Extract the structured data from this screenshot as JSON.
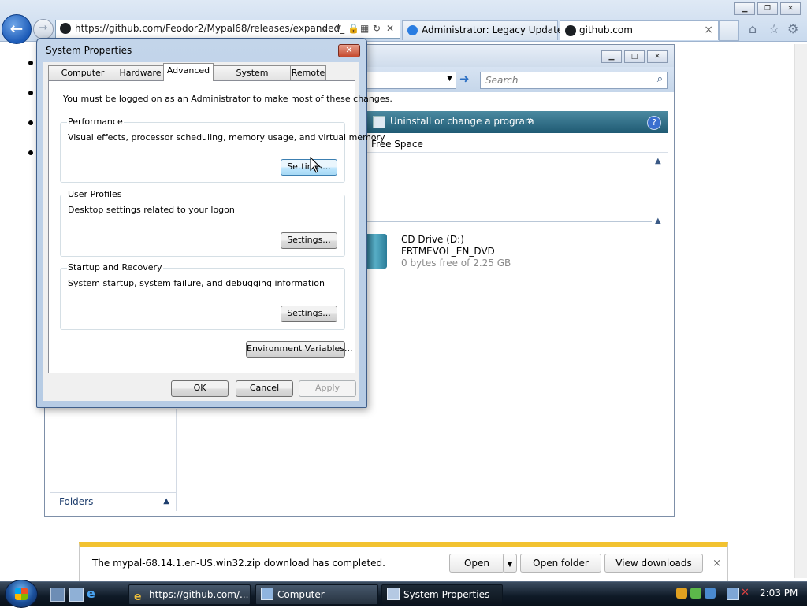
{
  "browser": {
    "address_url": "https://github.com/Feodor2/Mypal68/releases/expanded_",
    "tabs": [
      {
        "label": "Administrator: Legacy Update"
      },
      {
        "label": "github.com"
      }
    ],
    "tab_close_glyph": "×"
  },
  "explorer": {
    "search_placeholder": "Search",
    "uninstall_label": "Uninstall or change a program",
    "uninstall_more": "»",
    "help_glyph": "?",
    "free_space_column": "Free Space",
    "cd_drive": {
      "name": "CD Drive (D:)",
      "volume": "FRTMEVOL_EN_DVD",
      "free": "0 bytes free of 2.25 GB"
    },
    "folders_label": "Folders"
  },
  "system_properties": {
    "title": "System Properties",
    "close_glyph": "✕",
    "tabs": [
      "Computer Name",
      "Hardware",
      "Advanced",
      "System Protection",
      "Remote"
    ],
    "active_tab": "Advanced",
    "admin_note": "You must be logged on as an Administrator to make most of these changes.",
    "groups": [
      {
        "title": "Performance",
        "description": "Visual effects, processor scheduling, memory usage, and virtual memory",
        "button": "Settings..."
      },
      {
        "title": "User Profiles",
        "description": "Desktop settings related to your logon",
        "button": "Settings..."
      },
      {
        "title": "Startup and Recovery",
        "description": "System startup, system failure, and debugging information",
        "button": "Settings..."
      }
    ],
    "env_button": "Environment Variables...",
    "ok_label": "OK",
    "cancel_label": "Cancel",
    "apply_label": "Apply"
  },
  "download_bar": {
    "message": "The mypal-68.14.1.en-US.win32.zip download has completed.",
    "open_label": "Open",
    "open_folder_label": "Open folder",
    "view_downloads_label": "View downloads",
    "close_glyph": "×"
  },
  "taskbar": {
    "tasks": [
      {
        "label": "https://github.com/...",
        "icon": "ie-icon"
      },
      {
        "label": "Computer",
        "icon": "computer-icon"
      },
      {
        "label": "System Properties",
        "icon": "system-properties-icon"
      }
    ],
    "clock": "2:03 PM"
  },
  "colors": {
    "explorer_command_bar": "#2a6a84",
    "download_bar_accent": "#f2c230",
    "dialog_frame": "#b6cbe4",
    "hover_button": "#bee6fd"
  }
}
